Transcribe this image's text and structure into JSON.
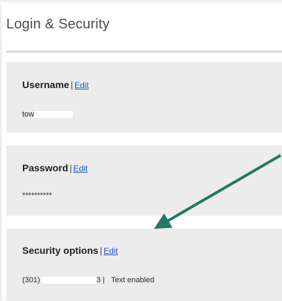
{
  "page": {
    "title": "Login & Security"
  },
  "sections": {
    "username": {
      "label": "Username",
      "separator": "|",
      "edit_label": "Edit",
      "value_prefix": "tow"
    },
    "password": {
      "label": "Password",
      "separator": "|",
      "edit_label": "Edit",
      "value": "**********"
    },
    "security_options": {
      "label": "Security options",
      "separator": "|",
      "edit_label": "Edit",
      "phone_prefix": "(301)",
      "phone_suffix": "3 |",
      "status": "Text enabled"
    }
  },
  "annotation": {
    "arrow_color": "#1e7a62"
  },
  "colors": {
    "link": "#1a56c8",
    "card_background": "#ececec",
    "page_background": "#ffffff"
  }
}
